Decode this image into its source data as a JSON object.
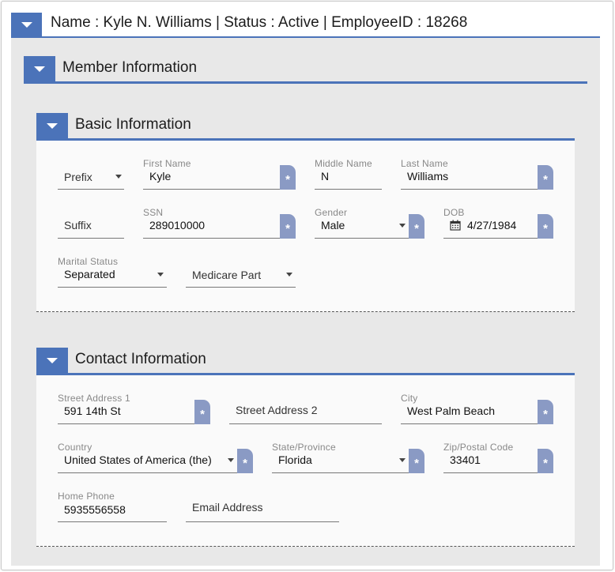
{
  "header": {
    "title": "Name : Kyle N. Williams | Status : Active | EmployeeID : 18268"
  },
  "member": {
    "title": "Member Information"
  },
  "basic": {
    "title": "Basic Information",
    "prefix": {
      "placeholder": "Prefix"
    },
    "first_name": {
      "label": "First Name",
      "value": "Kyle"
    },
    "middle_name": {
      "label": "Middle Name",
      "value": "N"
    },
    "last_name": {
      "label": "Last Name",
      "value": "Williams"
    },
    "suffix": {
      "placeholder": "Suffix"
    },
    "ssn": {
      "label": "SSN",
      "value": "289010000"
    },
    "gender": {
      "label": "Gender",
      "value": "Male"
    },
    "dob": {
      "label": "DOB",
      "value": "4/27/1984"
    },
    "marital_status": {
      "label": "Marital Status",
      "value": "Separated"
    },
    "medicare_part": {
      "placeholder": "Medicare Part"
    }
  },
  "contact": {
    "title": "Contact Information",
    "street1": {
      "label": "Street Address 1",
      "value": "591 14th St"
    },
    "street2": {
      "placeholder": "Street Address 2"
    },
    "city": {
      "label": "City",
      "value": "West Palm Beach"
    },
    "country": {
      "label": "Country",
      "value": "United States of America (the)"
    },
    "state": {
      "label": "State/Province",
      "value": "Florida"
    },
    "zip": {
      "label": "Zip/Postal Code",
      "value": "33401"
    },
    "home_phone": {
      "label": "Home Phone",
      "value": "5935556558"
    },
    "email": {
      "placeholder": "Email Address"
    }
  },
  "required_mark": "*",
  "colors": {
    "accent": "#4b73b9",
    "required": "#8a9ac4",
    "panel": "#e8e8e8",
    "card": "#fafafa"
  },
  "icons": {
    "toggle": "caret-down-icon",
    "calendar": "calendar-icon",
    "dropdown": "dropdown-caret-icon"
  }
}
